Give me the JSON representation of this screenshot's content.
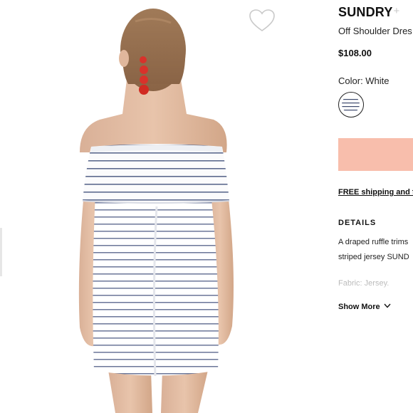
{
  "product": {
    "brand": "SUNDRY",
    "brand_plus": "+",
    "name": "Off Shoulder Dres",
    "price": "$108.00",
    "color_label": "Color: White",
    "add_button_color": "#f8beac"
  },
  "shipping": {
    "label": "FREE shipping and f"
  },
  "details": {
    "heading": "DETAILS",
    "line1": "A draped ruffle trims",
    "line2": "striped jersey SUND",
    "fabric": "Fabric: Jersey.",
    "show_more": "Show More"
  },
  "icons": {
    "wishlist": "heart-outline-icon",
    "swatch": "striped-fabric-swatch",
    "show_more": "chevron-down-icon"
  }
}
